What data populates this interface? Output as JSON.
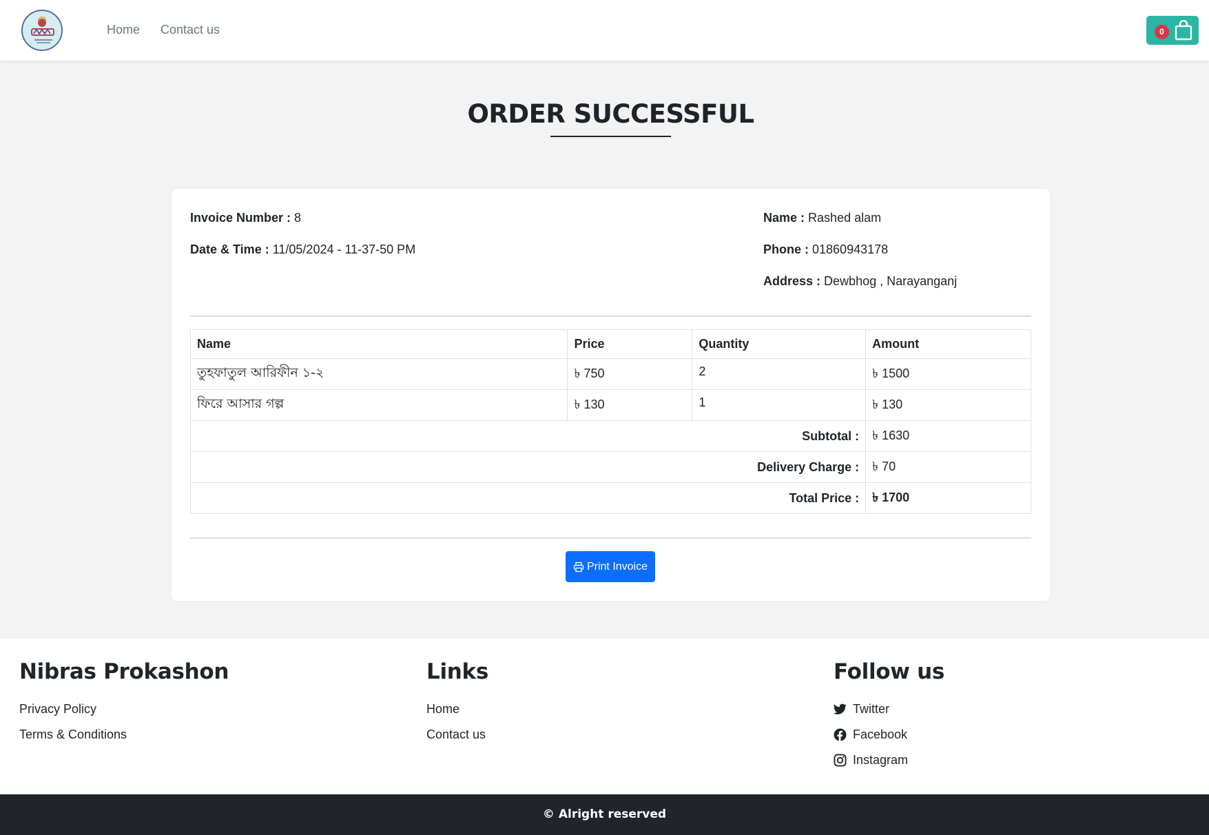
{
  "nav": {
    "home": "Home",
    "contact": "Contact us",
    "cart_count": "0"
  },
  "page": {
    "title": "ORDER SUCCESSFUL"
  },
  "invoice": {
    "number_label": "Invoice Number :",
    "number": "8",
    "datetime_label": "Date & Time :",
    "datetime": "11/05/2024 - 11-37-50 PM",
    "name_label": "Name :",
    "name": "Rashed alam",
    "phone_label": "Phone :",
    "phone": "01860943178",
    "address_label": "Address :",
    "address": "Dewbhog , Narayanganj"
  },
  "table": {
    "headers": [
      "Name",
      "Price",
      "Quantity",
      "Amount"
    ],
    "rows": [
      {
        "name": "তুহফাতুল আরিফীন ১-২",
        "price": "৳ 750",
        "quantity": "2",
        "amount": "৳ 1500"
      },
      {
        "name": "ফিরে আসার গল্প",
        "price": "৳ 130",
        "quantity": "1",
        "amount": "৳ 130"
      }
    ],
    "subtotal_label": "Subtotal :",
    "subtotal": "৳ 1630",
    "delivery_label": "Delivery Charge :",
    "delivery": "৳ 70",
    "total_label": "Total Price :",
    "total": "৳ 1700"
  },
  "print_label": "Print Invoice",
  "footer": {
    "brand": "Nibras Prokashon",
    "privacy": "Privacy Policy",
    "terms": "Terms & Conditions",
    "links_title": "Links",
    "home": "Home",
    "contact": "Contact us",
    "follow_title": "Follow us",
    "twitter": "Twitter",
    "facebook": "Facebook",
    "instagram": "Instagram",
    "copyright": "© Alright reserved"
  },
  "colors": {
    "accent": "#2bb5a5",
    "badge": "#dc3545",
    "primary": "#0d6efd",
    "dark": "#212529"
  }
}
